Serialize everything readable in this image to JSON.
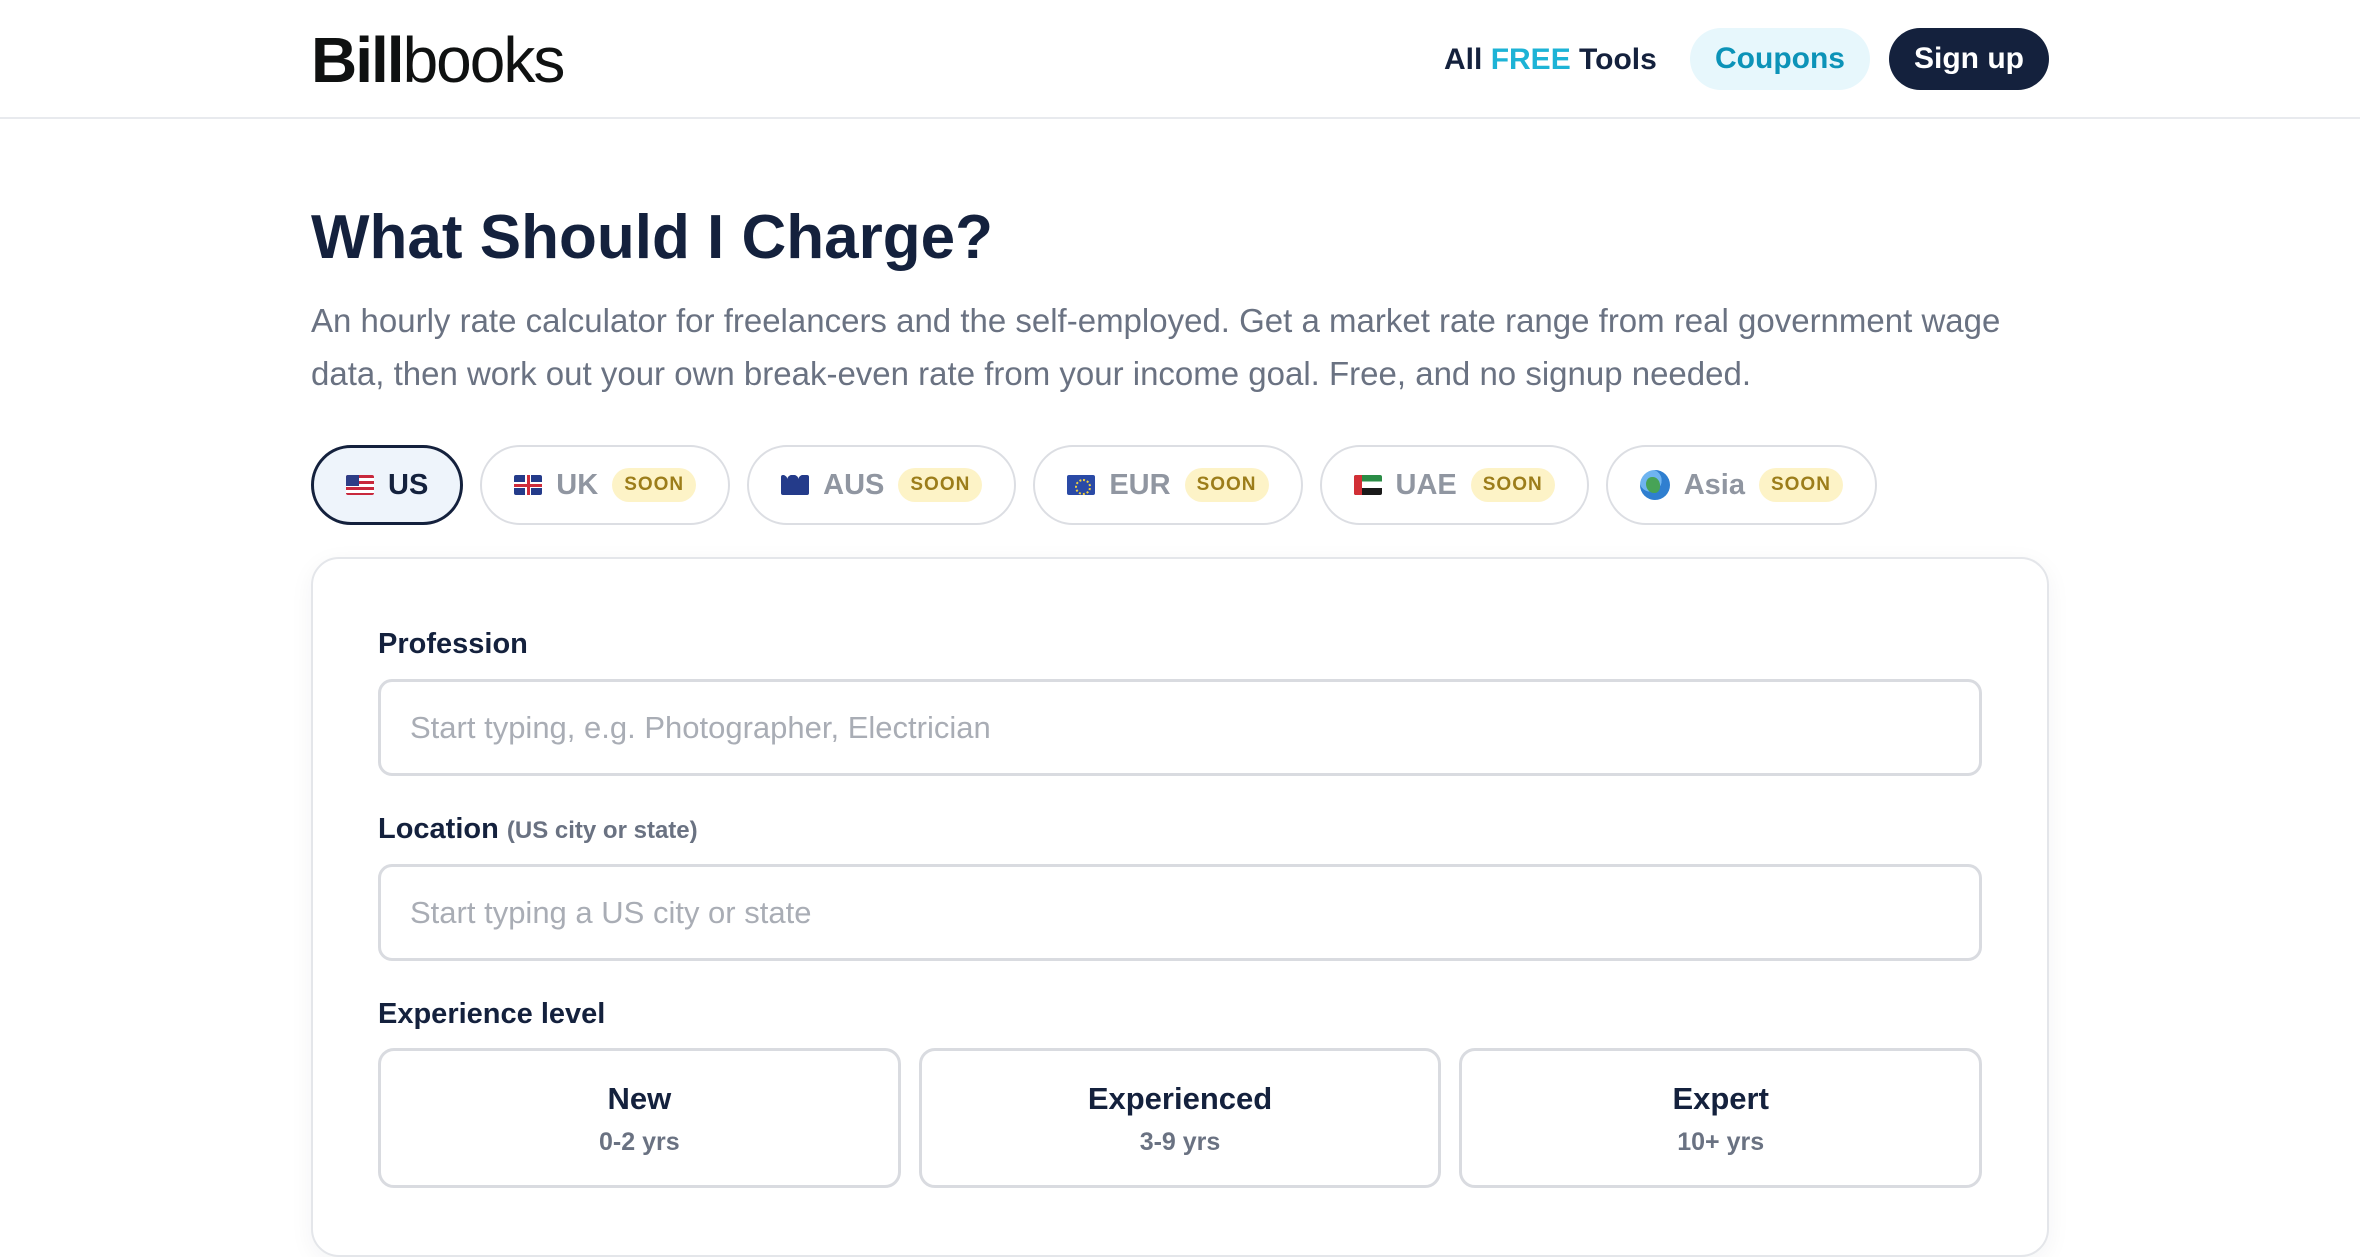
{
  "header": {
    "logo_bold": "Bill",
    "logo_light": "books",
    "tools_prefix": "All",
    "tools_highlight": "FREE",
    "tools_suffix": "Tools",
    "coupons_label": "Coupons",
    "signup_label": "Sign up",
    "accent_color": "#1db3d6",
    "brand_dark": "#14213d"
  },
  "hero": {
    "title": "What Should I Charge?",
    "description": "An hourly rate calculator for freelancers and the self-employed. Get a market rate range from real government wage data, then work out your own break-even rate from your income goal. Free, and no signup needed."
  },
  "regions": [
    {
      "label": "US",
      "icon": "us-flag-icon",
      "active": true,
      "badge": ""
    },
    {
      "label": "UK",
      "icon": "uk-flag-icon",
      "active": false,
      "badge": "SOON"
    },
    {
      "label": "AUS",
      "icon": "australia-flag-icon",
      "active": false,
      "badge": "SOON"
    },
    {
      "label": "EUR",
      "icon": "eu-flag-icon",
      "active": false,
      "badge": "SOON"
    },
    {
      "label": "UAE",
      "icon": "uae-flag-icon",
      "active": false,
      "badge": "SOON"
    },
    {
      "label": "Asia",
      "icon": "globe-icon",
      "active": false,
      "badge": "SOON"
    }
  ],
  "form": {
    "profession": {
      "label": "Profession",
      "placeholder": "Start typing, e.g. Photographer, Electrician",
      "value": ""
    },
    "location": {
      "label": "Location",
      "hint": "(US city or state)",
      "placeholder": "Start typing a US city or state",
      "value": ""
    },
    "experience": {
      "label": "Experience level",
      "options": [
        {
          "title": "New",
          "range": "0-2 yrs"
        },
        {
          "title": "Experienced",
          "range": "3-9 yrs"
        },
        {
          "title": "Expert",
          "range": "10+ yrs"
        }
      ]
    }
  }
}
